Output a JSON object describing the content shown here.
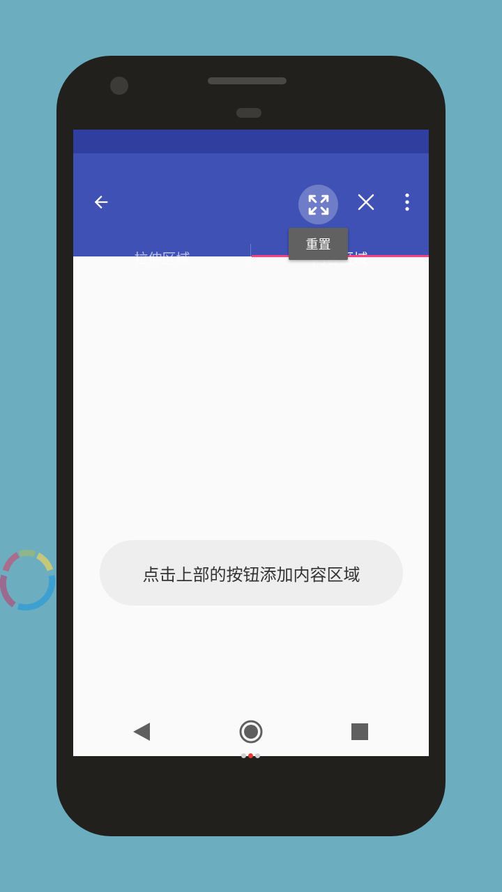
{
  "appbar": {
    "back_icon": "arrow-left-icon",
    "expand_icon": "fullscreen-expand-icon",
    "close_icon": "close-icon",
    "more_icon": "more-vert-icon",
    "tooltip": "重置"
  },
  "tabs": [
    {
      "label": "拉伸区域",
      "selected": false
    },
    {
      "label": "内容区域",
      "selected": true
    }
  ],
  "toast": {
    "message": "点击上部的按钮添加内容区域"
  },
  "colors": {
    "background": "#6caebf",
    "status_bar": "#303f9f",
    "app_bar": "#3f51b5",
    "tab_indicator": "#ff4081",
    "screen": "#fafafa"
  },
  "navbar": {
    "back_icon": "nav-back-triangle-icon",
    "home_icon": "nav-home-circle-icon",
    "recent_icon": "nav-recent-square-icon"
  }
}
